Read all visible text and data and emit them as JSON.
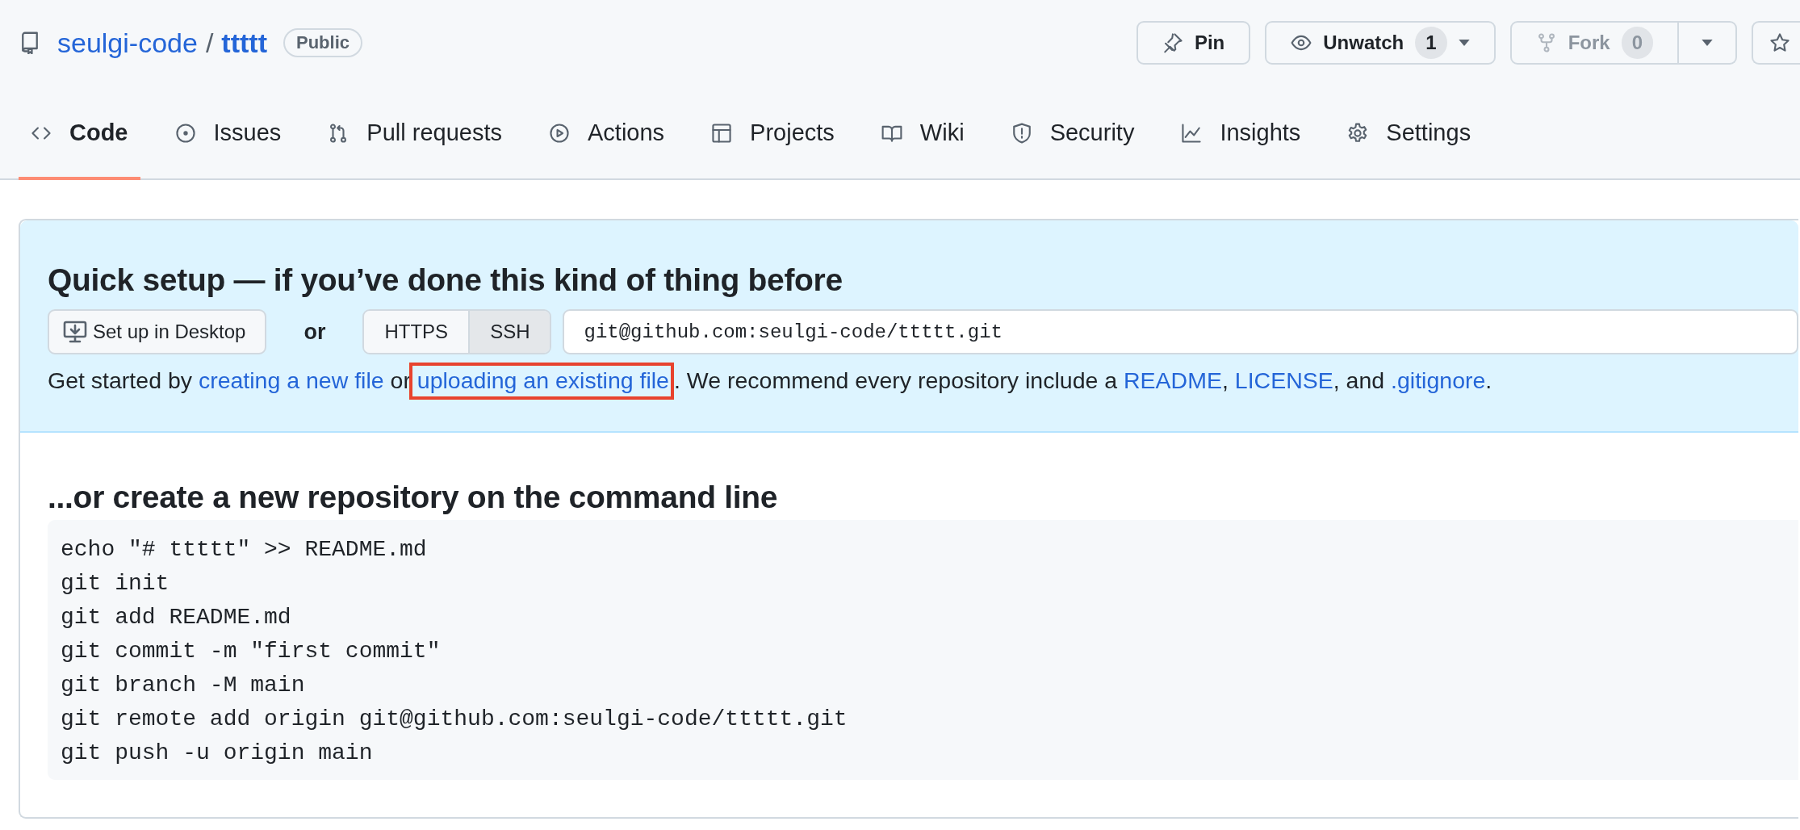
{
  "repo": {
    "owner": "seulgi-code",
    "separator": "/",
    "name": "ttttt",
    "visibility": "Public"
  },
  "actions": [
    {
      "kind": "pin",
      "label": "Pin",
      "disabled": false
    },
    {
      "kind": "watch",
      "label": "Unwatch",
      "count": "1",
      "menu": true,
      "disabled": false
    },
    {
      "kind": "fork",
      "label": "Fork",
      "count": "0",
      "menu": true,
      "disabled": true
    },
    {
      "kind": "star",
      "disabled": false
    }
  ],
  "tabs": [
    {
      "kind": "code",
      "label": "Code",
      "selected": true
    },
    {
      "kind": "issues",
      "label": "Issues",
      "selected": false
    },
    {
      "kind": "pulls",
      "label": "Pull requests",
      "selected": false
    },
    {
      "kind": "actions",
      "label": "Actions",
      "selected": false
    },
    {
      "kind": "projects",
      "label": "Projects",
      "selected": false
    },
    {
      "kind": "wiki",
      "label": "Wiki",
      "selected": false
    },
    {
      "kind": "security",
      "label": "Security",
      "selected": false
    },
    {
      "kind": "insights",
      "label": "Insights",
      "selected": false
    },
    {
      "kind": "settings",
      "label": "Settings",
      "selected": false
    }
  ],
  "quick_setup": {
    "title": "Quick setup — if you’ve done this kind of thing before",
    "desktop_button": "Set up in Desktop",
    "or": "or",
    "protocols": [
      {
        "label": "HTTPS",
        "selected": false
      },
      {
        "label": "SSH",
        "selected": true
      }
    ],
    "clone_url": "git@github.com:seulgi-code/ttttt.git",
    "instructions": [
      {
        "kind": "text",
        "text": "Get started by "
      },
      {
        "kind": "link",
        "text": "creating a new file",
        "highlighted": false
      },
      {
        "kind": "text",
        "text": " or "
      },
      {
        "kind": "link",
        "text": "uploading an existing file",
        "highlighted": true
      },
      {
        "kind": "text",
        "text": ". We recommend every repository include a "
      },
      {
        "kind": "link",
        "text": "README",
        "highlighted": false
      },
      {
        "kind": "text",
        "text": ", "
      },
      {
        "kind": "link",
        "text": "LICENSE",
        "highlighted": false
      },
      {
        "kind": "text",
        "text": ", and "
      },
      {
        "kind": "link",
        "text": ".gitignore",
        "highlighted": false
      },
      {
        "kind": "text",
        "text": "."
      }
    ]
  },
  "command_line": {
    "title": "...or create a new repository on the command line",
    "lines": [
      "echo \"# ttttt\" >> README.md",
      "git init",
      "git add README.md",
      "git commit -m \"first commit\"",
      "git branch -M main",
      "git remote add origin git@github.com:seulgi-code/ttttt.git",
      "git push -u origin main"
    ]
  }
}
